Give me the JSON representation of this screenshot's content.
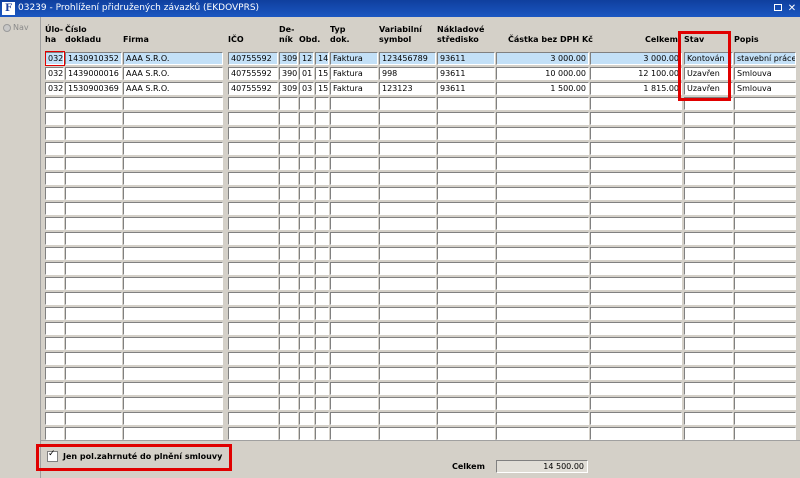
{
  "window": {
    "title": "03239 - Prohlížení přidružených závazků (EKDOVPRS)",
    "close_label": "✕"
  },
  "nav": {
    "label": "Nav"
  },
  "columns": [
    "Úlo-\nha",
    "Číslo\ndokladu",
    "Firma",
    "IČO",
    "De-\nník",
    "Obd.",
    "Typ\ndok.",
    "Variabilní\nsymbol",
    "Nákladové\nstředisko",
    "Částka bez DPH Kč",
    "Celkem",
    "Stav",
    "Popis"
  ],
  "rows": [
    [
      "032",
      "1430910352",
      "AAA S.R.O.",
      "40755592",
      "309",
      "12",
      "14",
      "Faktura",
      "123456789",
      "93611",
      "3 000.00",
      "3 000.00",
      "Kontován",
      "stavební práce"
    ],
    [
      "032",
      "1439000016",
      "AAA S.R.O.",
      "40755592",
      "390",
      "01",
      "15",
      "Faktura",
      "998",
      "93611",
      "10 000.00",
      "12 100.00",
      "Uzavřen",
      "Smlouva"
    ],
    [
      "032",
      "1530900369",
      "AAA S.R.O.",
      "40755592",
      "309",
      "03",
      "15",
      "Faktura",
      "123123",
      "93611",
      "1 500.00",
      "1 815.00",
      "Uzavřen",
      "Smlouva"
    ]
  ],
  "filter": {
    "checked": true,
    "label": "Jen pol.zahrnuté do plnění smlouvy"
  },
  "footer": {
    "total_label": "Celkem",
    "total_value": "14 500.00"
  }
}
